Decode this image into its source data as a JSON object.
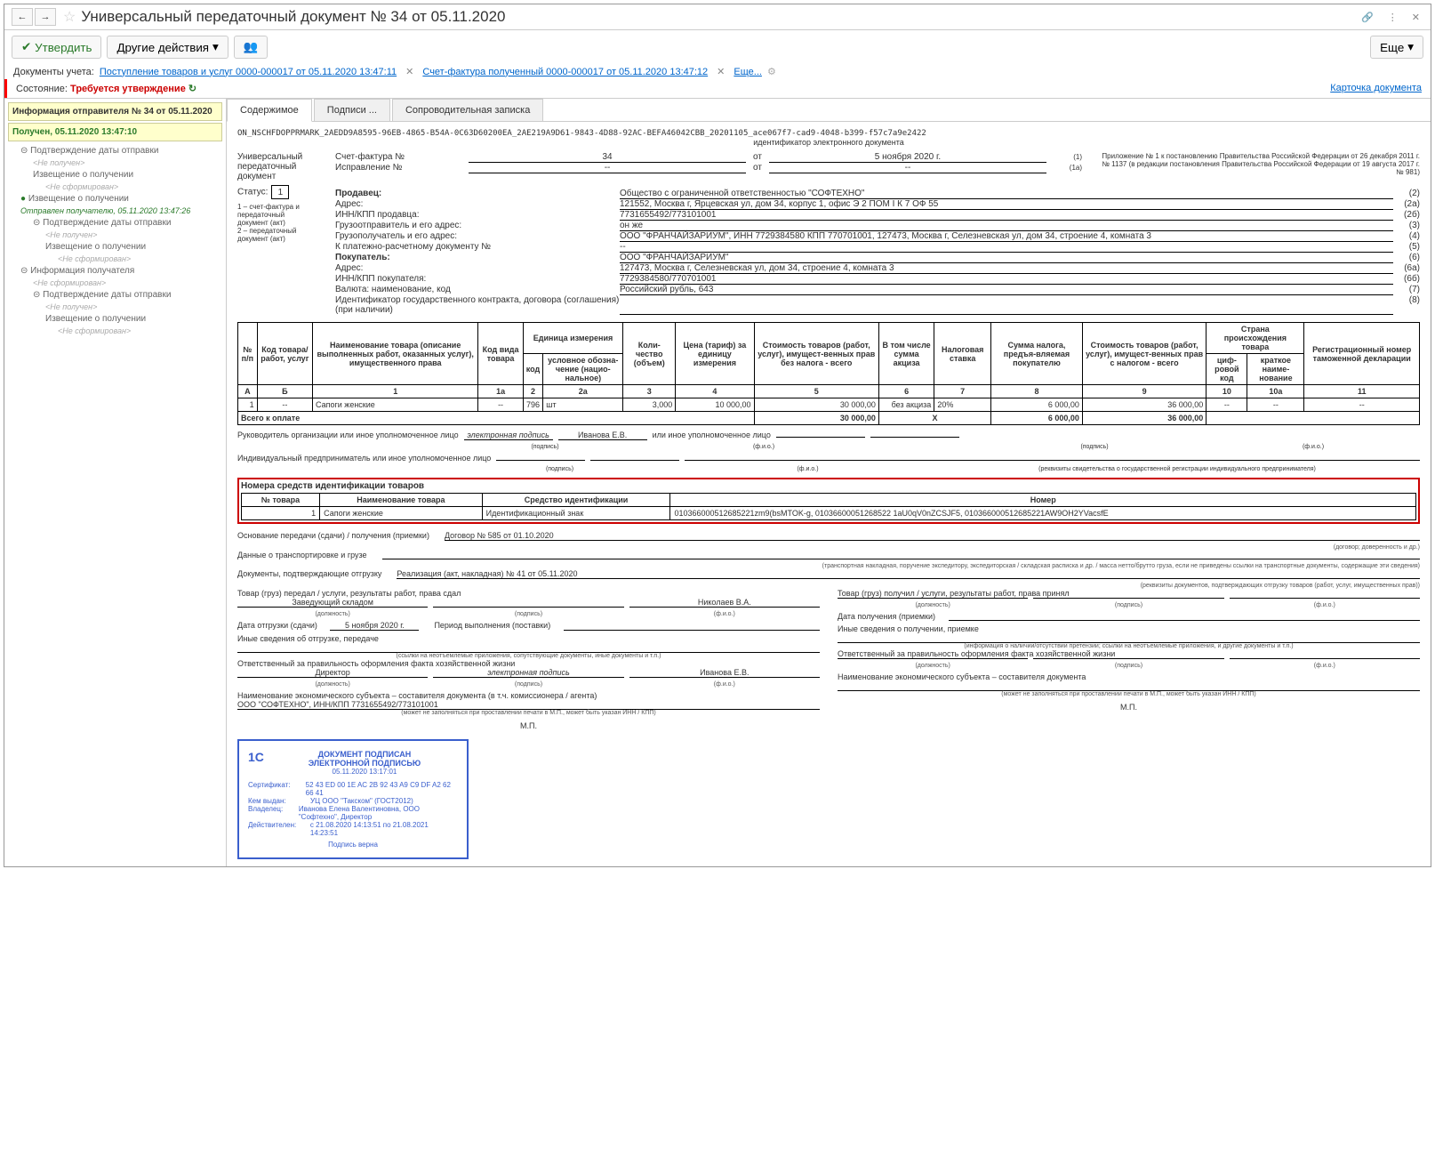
{
  "header": {
    "title": "Универсальный передаточный документ № 34 от 05.11.2020",
    "approve": "Утвердить",
    "other_actions": "Другие действия",
    "more_btn": "Еще"
  },
  "docline": {
    "label": "Документы учета:",
    "doc1": "Поступление товаров и услуг 0000-000017 от 05.11.2020 13:47:11",
    "doc2": "Счет-фактура полученный 0000-000017 от 05.11.2020 13:47:12",
    "more": "Еще..."
  },
  "status": {
    "label": "Состояние:",
    "value": "Требуется утверждение",
    "card": "Карточка документа"
  },
  "left": {
    "info_title": "Информация отправителя № 34 от 05.11.2020",
    "received": "Получен, 05.11.2020 13:47:10",
    "conf_date": "Подтверждение даты отправки",
    "not_received": "<Не получен>",
    "notice_receipt": "Извещение о получении",
    "not_formed": "<Не сформирован>",
    "notice_receipt2": "Извещение о получении",
    "sent": "Отправлен получателю, 05.11.2020 13:47:26",
    "conf_date2": "Подтверждение даты отправки",
    "receiver_info": "Информация получателя",
    "conf_date3": "Подтверждение даты отправки"
  },
  "tabs": {
    "t1": "Содержимое",
    "t2": "Подписи ...",
    "t3": "Сопроводительная записка"
  },
  "file": {
    "name": "ON_NSCHFDOPPRMARK_2AEDD9A8595-96EB-4865-B54A-0C63D60200EA_2AE219A9D61-9843-4D88-92AC-BEFA46042CBB_20201105_ace067f7-cad9-4048-b399-f57c7a9e2422",
    "sub": "идентификатор электронного документа"
  },
  "upd": {
    "title": "Универсальный передаточный документ",
    "status_label": "Статус:",
    "status_val": "1",
    "note1a": "1 – счет-фактура и передаточный документ (акт)",
    "note1b": "2 – передаточный документ (акт)",
    "sf_no": "Счет-фактура №",
    "sf_val": "34",
    "sf_date_lbl": "от",
    "sf_date": "5 ноября 2020 г.",
    "sf_num": "(1)",
    "corr_no": "Исправление №",
    "corr_val": "--",
    "corr_date": "--",
    "corr_num": "(1а)",
    "appendix": "Приложение № 1 к постановлению Правительства Российской Федерации от 26 декабря 2011 г. № 1137 (в редакции постановления Правительства Российской Федерации от 19 августа 2017 г. № 981)",
    "seller_lbl": "Продавец:",
    "seller_val": "Общество с ограниченной ответственностью \"СОФТЕХНО\"",
    "addr_lbl": "Адрес:",
    "addr_val": "121552, Москва г, Ярцевская ул, дом 34, корпус 1, офис Э 2 ПОМ I К 7 ОФ 55",
    "inn_seller_lbl": "ИНН/КПП продавца:",
    "inn_seller_val": "7731655492/773101001",
    "shipper_lbl": "Грузоотправитель и его адрес:",
    "shipper_val": "он же",
    "consignee_lbl": "Грузополучатель и его адрес:",
    "consignee_val": "ООО \"ФРАНЧАЙЗАРИУМ\", ИНН 7729384580 КПП 770701001, 127473, Москва г, Селезневская ул, дом 34, строение 4, комната 3",
    "pay_lbl": "К платежно-расчетному документу №",
    "pay_val": "--",
    "buyer_lbl": "Покупатель:",
    "buyer_val": "ООО \"ФРАНЧАЙЗАРИУМ\"",
    "buyer_addr_lbl": "Адрес:",
    "buyer_addr_val": "127473, Москва г, Селезневская ул, дом 34, строение 4, комната 3",
    "inn_buyer_lbl": "ИНН/КПП покупателя:",
    "inn_buyer_val": "7729384580/770701001",
    "curr_lbl": "Валюта: наименование, код",
    "curr_val": "Российский рубль, 643",
    "contract_lbl": "Идентификатор государственного контракта, договора (соглашения) (при наличии)"
  },
  "nums": {
    "n2": "(2)",
    "n2a": "(2а)",
    "n2b": "(2б)",
    "n3": "(3)",
    "n4": "(4)",
    "n5": "(5)",
    "n6": "(6)",
    "n6a": "(6а)",
    "n6b": "(6б)",
    "n7": "(7)",
    "n8": "(8)"
  },
  "items_header": {
    "c1": "№ п/п",
    "c2": "Код товара/ работ, услуг",
    "c3": "Наименование товара (описание выполненных работ, оказанных услуг), имущественного права",
    "c4": "Код вида товара",
    "c5": "Единица измерения",
    "c5a": "код",
    "c5b": "условное обозна-чение (нацио-нальное)",
    "c6": "Коли-чество (объем)",
    "c7": "Цена (тариф) за единицу измерения",
    "c8": "Стоимость товаров (работ, услуг), имущест-венных прав без налога - всего",
    "c9": "В том числе сумма акциза",
    "c10": "Налоговая ставка",
    "c11": "Сумма налога, предъя-вляемая покупателю",
    "c12": "Стоимость товаров (работ, услуг), имущест-венных прав с налогом - всего",
    "c13": "Страна происхождения товара",
    "c13a": "циф-ровой код",
    "c13b": "краткое наиме-нование",
    "c14": "Регистрационный номер таможенной декларации",
    "r": "А",
    "rb": "Б",
    "r1": "1",
    "r1a": "1а",
    "r2": "2",
    "r2a": "2а",
    "r3": "3",
    "r4": "4",
    "r5": "5",
    "r6": "6",
    "r7": "7",
    "r8": "8",
    "r9": "9",
    "r10": "10",
    "r10a": "10а",
    "r11": "11"
  },
  "items": [
    {
      "n": "1",
      "code": "--",
      "name": "Сапоги женские",
      "type": "--",
      "ucode": "796",
      "uname": "шт",
      "qty": "3,000",
      "price": "10 000,00",
      "sum_no_tax": "30 000,00",
      "excise": "без акциза",
      "rate": "20%",
      "tax": "6 000,00",
      "sum_tax": "36 000,00",
      "country_code": "--",
      "country_name": "--",
      "decl": "--"
    }
  ],
  "total": {
    "label": "Всего к оплате",
    "sum_no_tax": "30 000,00",
    "x": "Х",
    "tax": "6 000,00",
    "sum_tax": "36 000,00"
  },
  "sig": {
    "head_lbl": "Руководитель организации или иное уполномоченное лицо",
    "esig": "электронная подпись",
    "head_name": "Иванова Е.В.",
    "or_auth": "или иное уполномоченное лицо",
    "ip_lbl": "Индивидуальный предприниматель или иное уполномоченное лицо",
    "sub_sig": "(подпись)",
    "sub_fio": "(ф.и.о.)",
    "ip_note": "(реквизиты свидетельства о государственной регистрации индивидуального предпринимателя)"
  },
  "ident": {
    "title": "Номера средств идентификации товаров",
    "h1": "№ товара",
    "h2": "Наименование товара",
    "h3": "Средство идентификации",
    "h4": "Номер",
    "r_num": "1",
    "r_name": "Сапоги женские",
    "r_type": "Идентификационный знак",
    "r_val": "010366000512685221zm9(bsMTOK-g, 01036600051268522 1aU0qV0nZCSJF5, 010366000512685221AW9OH2YVacsfE"
  },
  "transfer": {
    "basis_lbl": "Основание передачи (сдачи) / получения (приемки)",
    "basis_val": "Договор № 585 от 01.10.2020",
    "basis_sub": "(договор; доверенность и др.)",
    "trans_lbl": "Данные о транспортировке и грузе",
    "trans_sub": "(транспортная накладная, поручение экспедитору, экспедиторская / складская расписка и др. / масса нетто/брутто груза, если не приведены ссылки на транспортные документы, содержащие эти сведения)",
    "docs_lbl": "Документы, подтверждающие отгрузку",
    "docs_val": "Реализация (акт, накладная) № 41 от 05.11.2020",
    "docs_sub": "(реквизиты документов, подтверждающих отгрузку товаров (работ, услуг, имущественных прав))",
    "left_give": "Товар (груз) передал / услуги, результаты работ, права сдал",
    "right_receive": "Товар (груз) получил / услуги, результаты работ, права принял",
    "head_store": "Заведующий складом",
    "head_name": "Николаев В.А.",
    "pos_sub": "(должность)",
    "sig_sub": "(подпись)",
    "fio_sub": "(ф.и.о.)",
    "ship_date_lbl": "Дата отгрузки (сдачи)",
    "ship_date": "5 ноября 2020 г.",
    "period_lbl": "Период выполнения (поставки)",
    "recv_date_lbl": "Дата получения (приемки)",
    "other_ship": "Иные сведения об отгрузке, передаче",
    "other_recv": "Иные сведения о получении, приемке",
    "other_sub_left": "(ссылки на неотъемлемые приложения, сопутствующие документы, иные документы и т.п.)",
    "other_sub_right": "(информация о наличии/отсутствии претензии; ссылки на неотъемлемые приложения, и другие документы и т.п.)",
    "resp_lbl": "Ответственный за правильность оформления факта хозяйственной жизни",
    "director": "Директор",
    "esig": "электронная подпись",
    "dir_name": "Иванова Е.В.",
    "econ_lbl": "Наименование экономического субъекта – составителя документа (в т.ч. комиссионера / агента)",
    "econ_lbl_r": "Наименование экономического субъекта – составителя документа",
    "econ_val": "ООО \"СОФТЕХНО\", ИНН/КПП 7731655492/773101001",
    "econ_sub": "(может не заполняться при проставлении печати в М.П., может быть указан ИНН / КПП)",
    "mp": "М.П."
  },
  "stamp": {
    "title1": "ДОКУМЕНТ ПОДПИСАН",
    "title2": "ЭЛЕКТРОННОЙ ПОДПИСЬЮ",
    "date": "05.11.2020 13:17:01",
    "cert_lbl": "Сертификат:",
    "cert": "52 43 ED 00 1E AC 2B 92 43 A9 C9 DF A2 62 66 41",
    "issued_lbl": "Кем выдан:",
    "issued": "УЦ ООО \"Такском\" (ГОСТ2012)",
    "owner_lbl": "Владелец:",
    "owner": "Иванова Елена Валентиновна, ООО \"Софтехно\", Директор",
    "valid_lbl": "Действителен:",
    "valid": "с 21.08.2020 14:13:51 по 21.08.2021 14:23:51",
    "verified": "Подпись верна"
  }
}
